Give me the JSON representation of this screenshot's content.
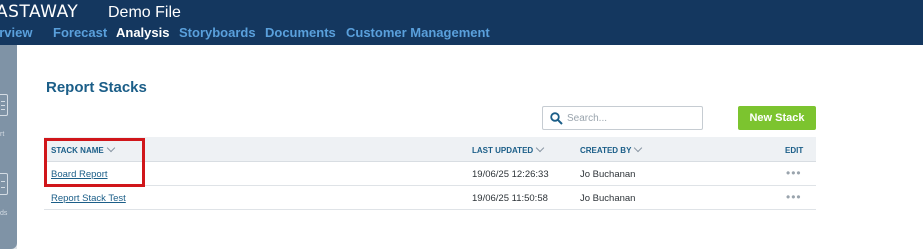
{
  "header": {
    "logo": "ASTAWAY",
    "file_title": "Demo File",
    "nav": [
      {
        "label": "erview"
      },
      {
        "label": "Forecast"
      },
      {
        "label": "Analysis"
      },
      {
        "label": "Storyboards"
      },
      {
        "label": "Documents"
      },
      {
        "label": "Customer Management"
      }
    ],
    "active_nav": "Analysis"
  },
  "left_strip": {
    "items": [
      {
        "label": "rt",
        "icon": "report-icon"
      },
      {
        "label": "ds",
        "icon": "storyboards-icon"
      }
    ]
  },
  "page": {
    "title": "Report Stacks"
  },
  "search": {
    "placeholder": "Search...",
    "value": ""
  },
  "new_stack_button": "New Stack",
  "table": {
    "columns": [
      "STACK NAME",
      "LAST UPDATED",
      "CREATED BY",
      "EDIT"
    ],
    "rows": [
      {
        "name": "Board Report",
        "last_updated": "19/06/25 12:26:33",
        "created_by": "Jo Buchanan",
        "edit": "•••"
      },
      {
        "name": "Report Stack Test",
        "last_updated": "19/06/25 11:50:58",
        "created_by": "Jo Buchanan",
        "edit": "•••"
      }
    ]
  },
  "colors": {
    "header_bg": "#14375f",
    "nav_link": "#5aa0dc",
    "accent_blue": "#1b5e88",
    "button_green": "#7cc42f",
    "highlight_red": "#d0161a"
  }
}
